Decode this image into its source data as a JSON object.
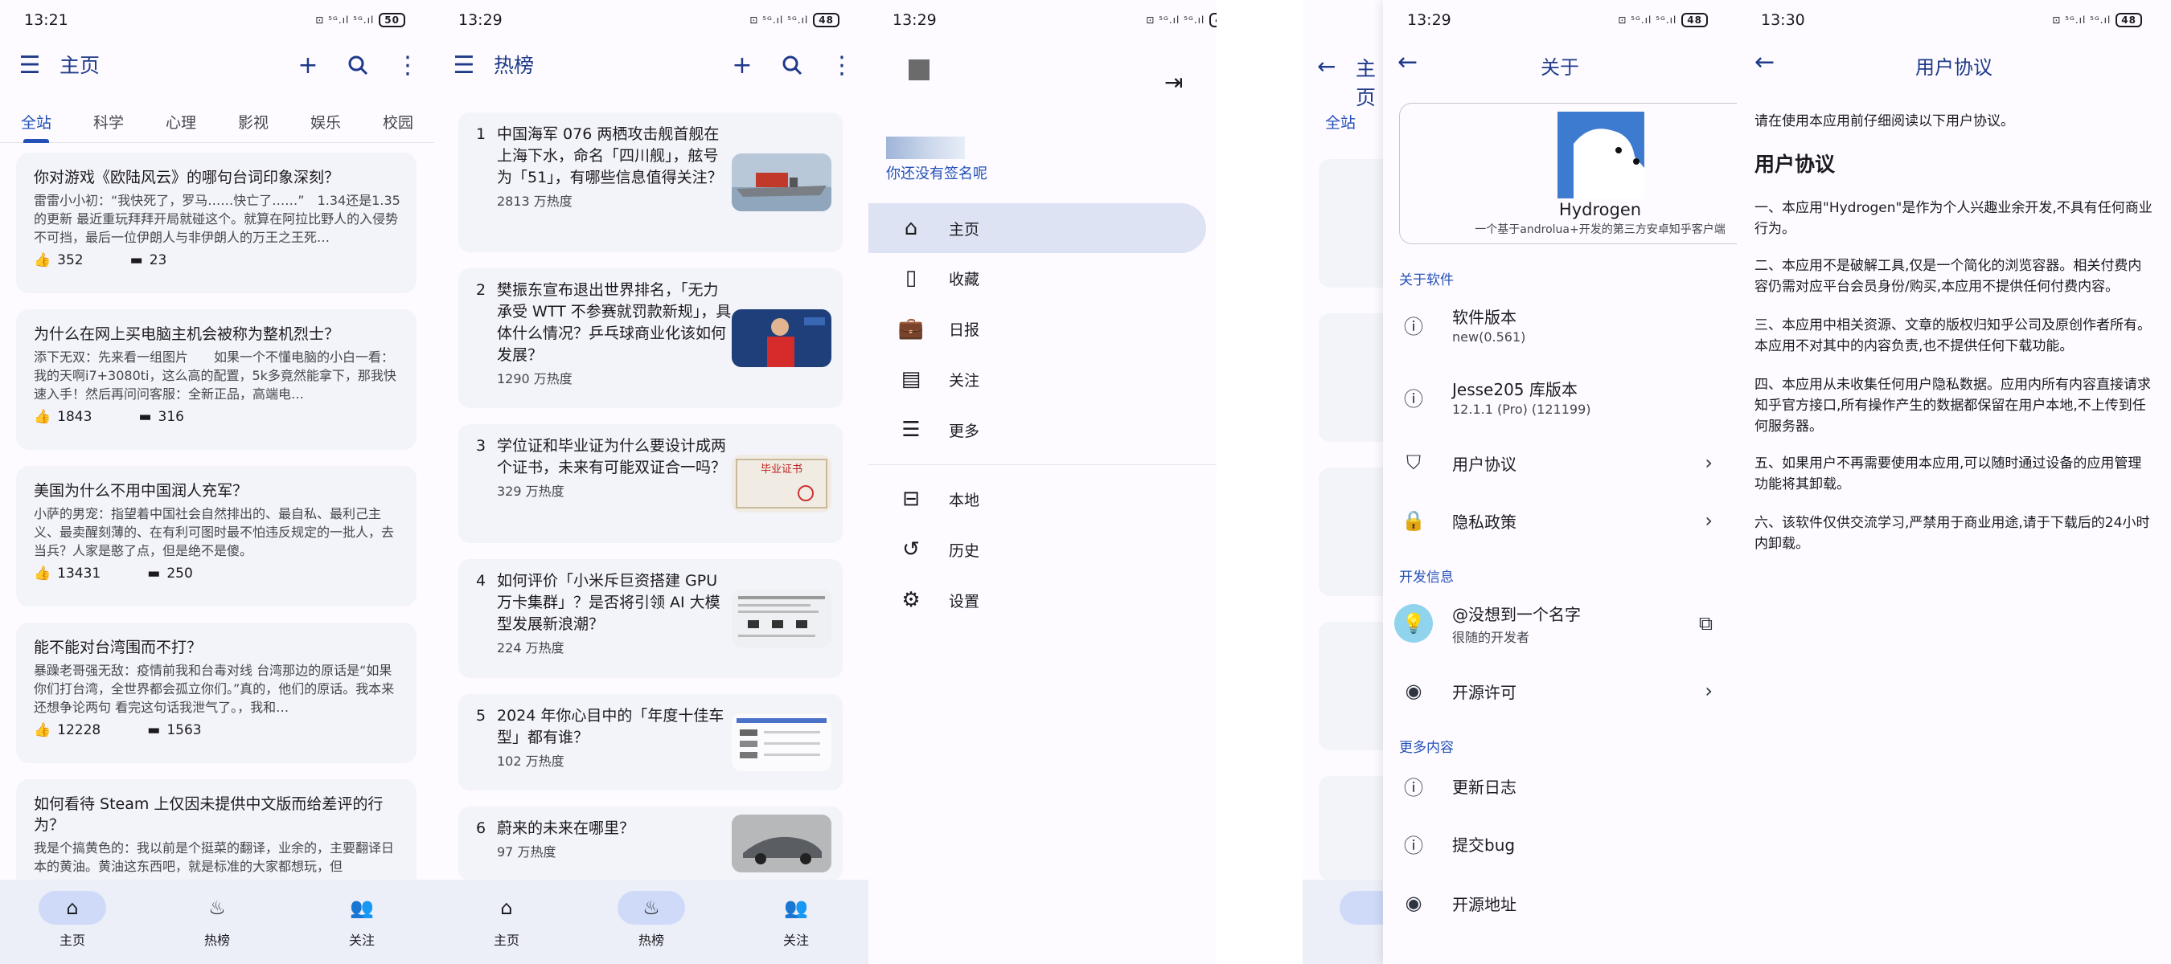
{
  "status": [
    {
      "time": "13:21",
      "batt": "50"
    },
    {
      "time": "13:29",
      "batt": "48"
    },
    {
      "time": "13:29",
      "batt": "48"
    },
    {
      "time": "13:29",
      "batt": "48"
    },
    {
      "time": "13:30",
      "batt": "48"
    }
  ],
  "status_icons": "⊡ ⁵ᴳ.ıl ⁵ᴳ.ıl",
  "panel1": {
    "title": "主页",
    "tabs": [
      "全站",
      "科学",
      "心理",
      "影视",
      "娱乐",
      "校园"
    ],
    "cards": [
      {
        "q": "你对游戏《欧陆风云》的哪句台词印象深刻？",
        "a": "雷雷小小初：“我快死了，罗马……快亡了……”　1.34还是1.35的更新 最近重玩拜拜开局就碰这个。就算在阿拉比野人的入侵势不可挡，最后一位伊朗人与非伊朗人的万王之王死…",
        "likes": "352",
        "comments": "23"
      },
      {
        "q": "为什么在网上买电脑主机会被称为整机烈士？",
        "a": "添下无双：先来看一组图片　　如果一个不懂电脑的小白一看：我的天啊i7+3080ti，这么高的配置，5k多竟然能拿下，那我快速入手！然后再问问客服：全新正品，高端电…",
        "likes": "1843",
        "comments": "316"
      },
      {
        "q": "美国为什么不用中国润人充军？",
        "a": "小萨的男宠：指望着中国社会自然排出的、最自私、最利己主义、最卖醒刻薄的、在有利可图时最不怕违反规定的一批人，去当兵？人家是憨了点，但是绝不是傻。",
        "likes": "13431",
        "comments": "250"
      },
      {
        "q": "能不能对台湾围而不打？",
        "a": "暴躁老哥强无敌：疫情前我和台毒对线 台湾那边的原话是“如果你们打台湾，全世界都会孤立你们。”真的，他们的原话。我本来还想争论两句 看完这句话我泄气了。，我和…",
        "likes": "12228",
        "comments": "1563"
      },
      {
        "q": "如何看待 Steam 上仅因未提供中文版而给差评的行为？",
        "a": "我是个搞黄色的：我以前是个挺菜的翻译，业余的，主要翻译日本的黄油。黄油这东西吧，就是标准的大家都想玩，但",
        "likes": "",
        "comments": ""
      }
    ]
  },
  "panel2": {
    "title": "热榜",
    "items": [
      {
        "n": "1",
        "t": "中国海军 076 两栖攻击舰首舰在上海下水，命名「四川舰」，舷号为「51」，有哪些信息值得关注？",
        "h": "2813 万热度"
      },
      {
        "n": "2",
        "t": "樊振东宣布退出世界排名，「无力承受 WTT 不参赛就罚款新规」，具体什么情况？乒乓球商业化该如何发展？",
        "h": "1290 万热度"
      },
      {
        "n": "3",
        "t": "学位证和毕业证为什么要设计成两个证书，未来有可能双证合一吗？",
        "h": "329 万热度"
      },
      {
        "n": "4",
        "t": "如何评价「小米斥巨资搭建 GPU 万卡集群」？是否将引领 AI 大模型发展新浪潮？",
        "h": "224 万热度"
      },
      {
        "n": "5",
        "t": "2024 年你心目中的「年度十佳车型」都有谁？",
        "h": "102 万热度"
      },
      {
        "n": "6",
        "t": "蔚来的未来在哪里？",
        "h": "97 万热度"
      }
    ],
    "thumb_text": "毕业证书"
  },
  "nav": [
    "主页",
    "热榜",
    "关注"
  ],
  "drawer": {
    "signature": "你还没有签名呢",
    "items": [
      "主页",
      "收藏",
      "日报",
      "关注",
      "更多",
      "本地",
      "历史",
      "设置"
    ]
  },
  "panel4": {
    "title": "关于",
    "app_name": "Hydrogen",
    "app_desc": "一个基于androlua+开发的第三方安卓知乎客户端",
    "sec_software": "关于软件",
    "version_label": "软件版本",
    "version_value": "new(0.561)",
    "lib_label": "Jesse205 库版本",
    "lib_value": "12.1.1 (Pro) (121199)",
    "agreement": "用户协议",
    "privacy": "隐私政策",
    "sec_dev": "开发信息",
    "dev_name": "@没想到一个名字",
    "dev_desc": "很随的开发者",
    "license": "开源许可",
    "sec_more": "更多内容",
    "changelog": "更新日志",
    "bug": "提交bug",
    "source": "开源地址"
  },
  "panel5": {
    "title": "用户协议",
    "intro": "请在使用本应用前仔细阅读以下用户协议。",
    "heading": "用户协议",
    "paras": [
      "一、本应用\"Hydrogen\"是作为个人兴趣业余开发,不具有任何商业行为。",
      "二、本应用不是破解工具,仅是一个简化的浏览容器。相关付费内容仍需对应平台会员身份/购买,本应用不提供任何付费内容。",
      "三、本应用中相关资源、文章的版权归知乎公司及原创作者所有。本应用不对其中的内容负责,也不提供任何下载功能。",
      "四、本应用从未收集任何用户隐私数据。应用内所有内容直接请求知乎官方接口,所有操作产生的数据都保留在用户本地,不上传到任何服务器。",
      "五、如果用户不再需要使用本应用,可以随时通过设备的应用管理功能将其卸载。",
      "六、该软件仅供交流学习,严禁用于商业用途,请于下载后的24小时内卸载。"
    ]
  }
}
